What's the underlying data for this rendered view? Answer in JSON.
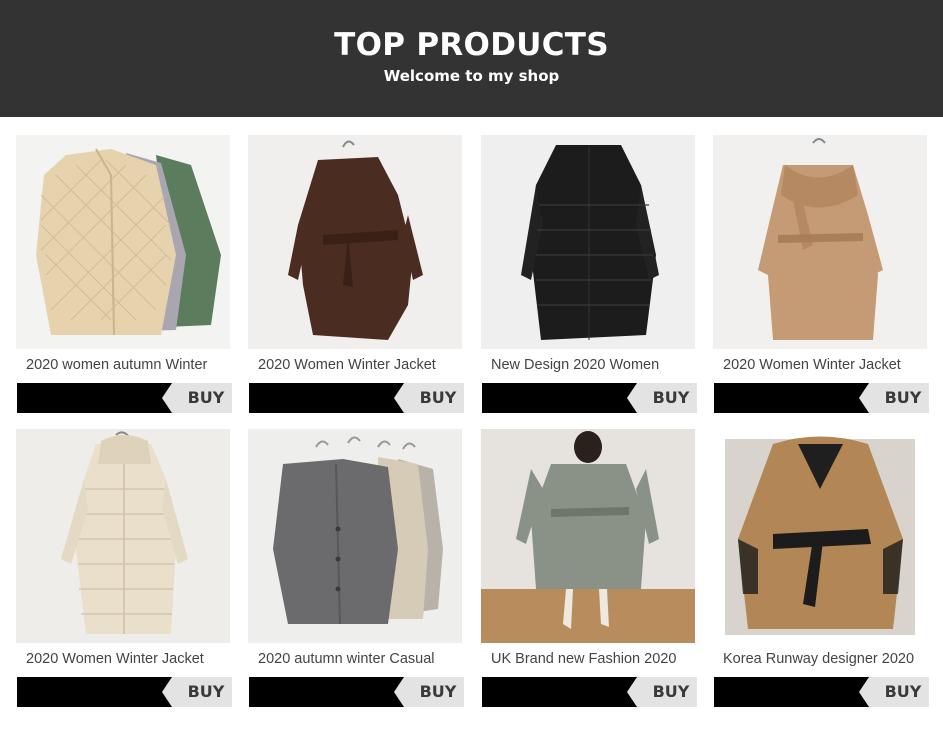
{
  "header": {
    "title": "TOP PRODUCTS",
    "subtitle": "Welcome to my shop",
    "background": "#333333"
  },
  "products": [
    {
      "name": "2020 women autumn Winter",
      "buy_label": "BUY",
      "image": "quilted-coats-image"
    },
    {
      "name": "2020 Women Winter Jacket",
      "buy_label": "BUY",
      "image": "brown-belted-coat-image"
    },
    {
      "name": "New Design 2020 Women",
      "buy_label": "BUY",
      "image": "black-puffer-coat-image"
    },
    {
      "name": "2020 Women Winter Jacket",
      "buy_label": "BUY",
      "image": "camel-scarf-coat-image"
    },
    {
      "name": "2020 Women Winter Jacket",
      "buy_label": "BUY",
      "image": "cream-hooded-puffer-image"
    },
    {
      "name": "2020 autumn winter Casual",
      "buy_label": "BUY",
      "image": "knit-cardigans-image"
    },
    {
      "name": "UK Brand new Fashion 2020",
      "buy_label": "BUY",
      "image": "green-trench-model-image"
    },
    {
      "name": "Korea Runway designer 2020",
      "buy_label": "BUY",
      "image": "camel-trench-model-image"
    }
  ]
}
